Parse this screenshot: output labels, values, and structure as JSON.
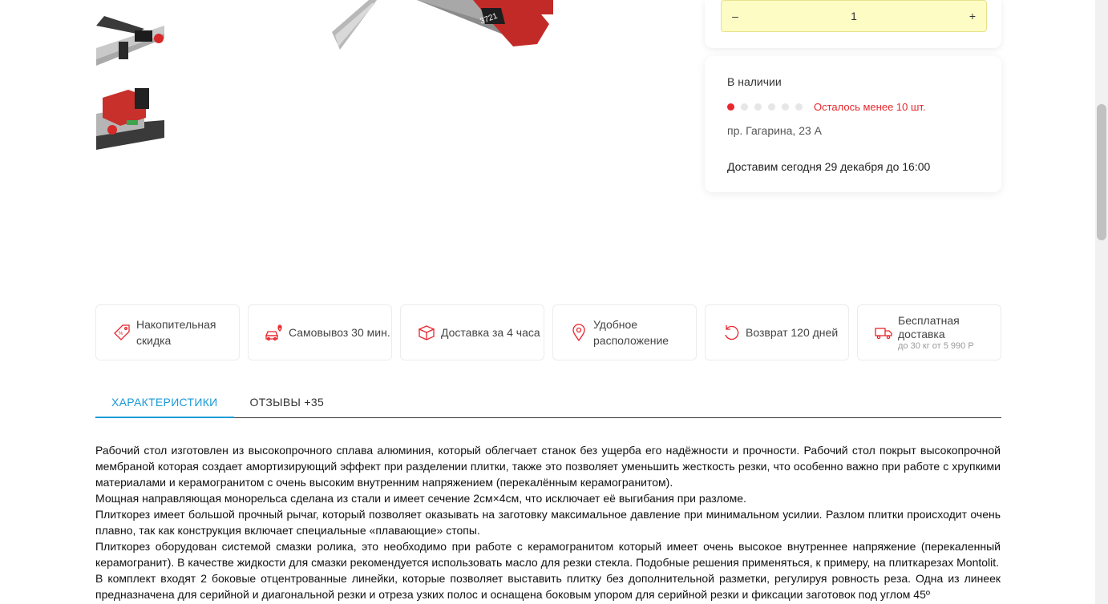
{
  "quantity": {
    "minus_label": "–",
    "value": "1",
    "plus_label": "+"
  },
  "availability": {
    "title": "В наличии",
    "stock_level": 1,
    "stock_total": 6,
    "stock_note": "Осталось менее 10 шт.",
    "address": "пр. Гагарина, 23 А",
    "delivery": "Доставим сегодня 29 декабря до 16:00",
    "accent_color": "#e8262c"
  },
  "features": [
    {
      "icon": "discount-tag-icon",
      "title": "Накопительная скидка"
    },
    {
      "icon": "car-pin-icon",
      "title": "Самовывоз 30 мин."
    },
    {
      "icon": "box-icon",
      "title": "Доставка за 4 часа"
    },
    {
      "icon": "location-pin-icon",
      "title": "Удобное расположение"
    },
    {
      "icon": "return-arrow-icon",
      "title": "Возврат 120 дней"
    },
    {
      "icon": "truck-icon",
      "title": "Бесплатная доставка",
      "subtitle": "до 30 кг от 5 990 Р"
    }
  ],
  "tabs": [
    {
      "label": "ХАРАКТЕРИСТИКИ",
      "active": true
    },
    {
      "label": "ОТЗЫВЫ +35",
      "active": false
    }
  ],
  "tab_accent_color": "#1a9ad6",
  "description": [
    "Рабочий стол изготовлен из высокопрочного сплава алюминия, который облегчает станок без ущерба его надёжности и прочности. Рабочий стол покрыт высокопрочной мембраной которая создает амортизирующий эффект при разделении плитки, также это позволяет уменьшить жесткость резки, что особенно важно при работе с хрупкими материалами и керамогранитом с очень высоким внутренним напряжением (перекалённым керамогранитом).",
    "Мощная направляющая монорельса сделана из стали и имеет сечение 2см×4см, что исключает её выгибания при разломе.",
    "Плиткорез имеет большой прочный рычаг, который позволяет оказывать на заготовку максимальное давление при минимальном усилии. Разлом плитки происходит очень плавно, так как конструкция включает специальные «плавающие» стопы.",
    "Плиткорез оборудован системой смазки ролика, это необходимо при работе с керамогранитом который имеет очень высокое внутреннее напряжение (перекаленный керамогранит). В качестве жидкости для смазки рекомендуется использовать масло для резки стекла. Подобные решения применяться, к примеру, на плиткарезах Montolit.",
    "В комплект входят 2 боковые отцентрованные линейки, которые позволяет выставить плитку без дополнительной разметки, регулируя ровность реза. Одна из линеек предназначена для серийной и диагональной резки и отреза узких полос и оснащена боковым упором для серийной резки и фиксации заготовок под углом 45º"
  ],
  "product_label": "3721"
}
